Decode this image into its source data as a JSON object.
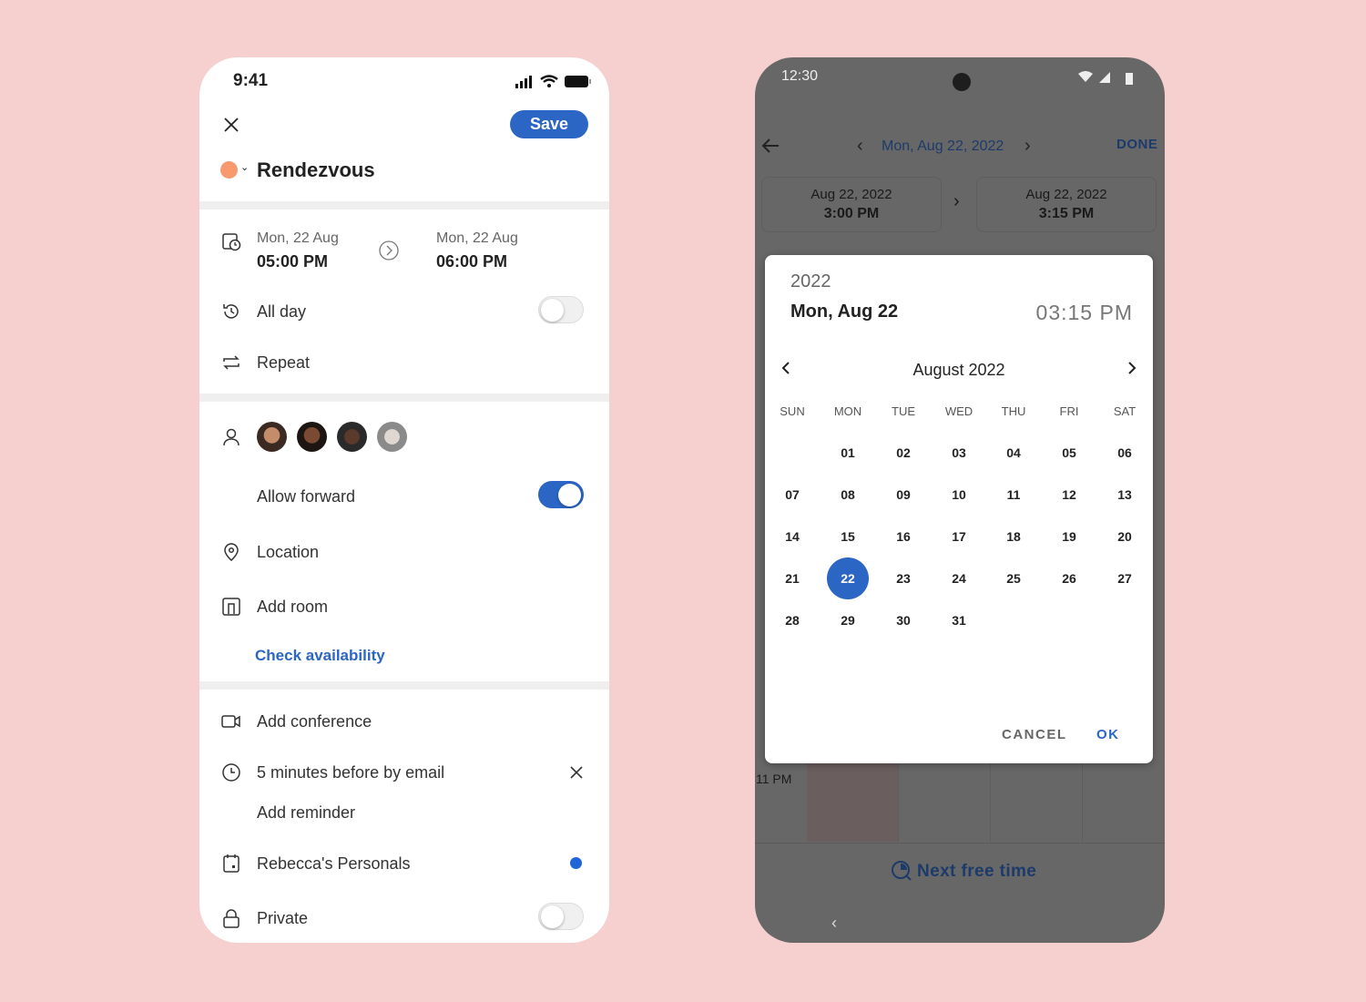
{
  "left_phone": {
    "status_time": "9:41",
    "close_icon": "close-icon",
    "save_label": "Save",
    "event_color": "#f89a6e",
    "event_title": "Rendezvous",
    "start_date": "Mon, 22 Aug",
    "start_time": "05:00 PM",
    "end_date": "Mon, 22 Aug",
    "end_time": "06:00 PM",
    "all_day_label": "All day",
    "all_day_on": false,
    "repeat_label": "Repeat",
    "allow_forward_label": "Allow forward",
    "allow_forward_on": true,
    "location_label": "Location",
    "add_room_label": "Add room",
    "check_availability_label": "Check availability",
    "add_conference_label": "Add conference",
    "reminder_label": "5 minutes before by email",
    "add_reminder_label": "Add reminder",
    "calendar_label": "Rebecca's Personals",
    "calendar_color": "#1f64d8",
    "private_label": "Private",
    "private_on": false,
    "accent": "#2b66c4"
  },
  "right_phone": {
    "status_time": "12:30",
    "header_date": "Mon, Aug 22, 2022",
    "done_label": "DONE",
    "start_box": {
      "date": "Aug 22, 2022",
      "time": "3:00 PM"
    },
    "end_box": {
      "date": "Aug 22, 2022",
      "time": "3:15 PM"
    },
    "hour_label": "11 PM",
    "next_free_label": "Next free time",
    "dialog": {
      "year": "2022",
      "date": "Mon, Aug 22",
      "time": "03:15 PM",
      "month": "August 2022",
      "weekdays": [
        "SUN",
        "MON",
        "TUE",
        "WED",
        "THU",
        "FRI",
        "SAT"
      ],
      "weeks": [
        [
          "",
          "01",
          "02",
          "03",
          "04",
          "05",
          "06"
        ],
        [
          "07",
          "08",
          "09",
          "10",
          "11",
          "12",
          "13"
        ],
        [
          "14",
          "15",
          "16",
          "17",
          "18",
          "19",
          "20"
        ],
        [
          "21",
          "22",
          "23",
          "24",
          "25",
          "26",
          "27"
        ],
        [
          "28",
          "29",
          "30",
          "31",
          "",
          "",
          ""
        ]
      ],
      "selected": "22",
      "cancel_label": "CANCEL",
      "ok_label": "OK"
    }
  }
}
